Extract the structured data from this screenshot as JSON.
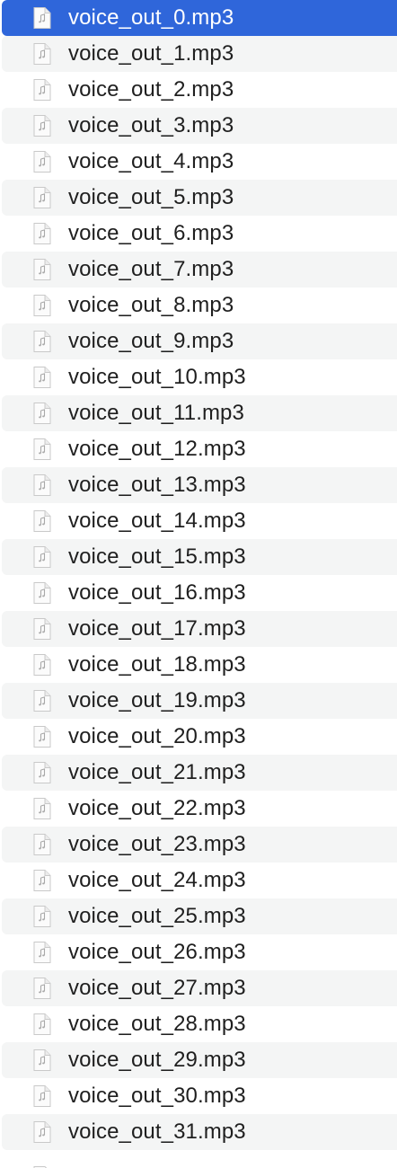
{
  "files": [
    {
      "name": "voice_out_0.mp3",
      "icon": "audio-file-icon",
      "selected": true
    },
    {
      "name": "voice_out_1.mp3",
      "icon": "audio-file-icon",
      "selected": false
    },
    {
      "name": "voice_out_2.mp3",
      "icon": "audio-file-icon",
      "selected": false
    },
    {
      "name": "voice_out_3.mp3",
      "icon": "audio-file-icon",
      "selected": false
    },
    {
      "name": "voice_out_4.mp3",
      "icon": "audio-file-icon",
      "selected": false
    },
    {
      "name": "voice_out_5.mp3",
      "icon": "audio-file-icon",
      "selected": false
    },
    {
      "name": "voice_out_6.mp3",
      "icon": "audio-file-icon",
      "selected": false
    },
    {
      "name": "voice_out_7.mp3",
      "icon": "audio-file-icon",
      "selected": false
    },
    {
      "name": "voice_out_8.mp3",
      "icon": "audio-file-icon",
      "selected": false
    },
    {
      "name": "voice_out_9.mp3",
      "icon": "audio-file-icon",
      "selected": false
    },
    {
      "name": "voice_out_10.mp3",
      "icon": "audio-file-icon",
      "selected": false
    },
    {
      "name": "voice_out_11.mp3",
      "icon": "audio-file-icon",
      "selected": false
    },
    {
      "name": "voice_out_12.mp3",
      "icon": "audio-file-icon",
      "selected": false
    },
    {
      "name": "voice_out_13.mp3",
      "icon": "audio-file-icon",
      "selected": false
    },
    {
      "name": "voice_out_14.mp3",
      "icon": "audio-file-icon",
      "selected": false
    },
    {
      "name": "voice_out_15.mp3",
      "icon": "audio-file-icon",
      "selected": false
    },
    {
      "name": "voice_out_16.mp3",
      "icon": "audio-file-icon",
      "selected": false
    },
    {
      "name": "voice_out_17.mp3",
      "icon": "audio-file-icon",
      "selected": false
    },
    {
      "name": "voice_out_18.mp3",
      "icon": "audio-file-icon",
      "selected": false
    },
    {
      "name": "voice_out_19.mp3",
      "icon": "audio-file-icon",
      "selected": false
    },
    {
      "name": "voice_out_20.mp3",
      "icon": "audio-file-icon",
      "selected": false
    },
    {
      "name": "voice_out_21.mp3",
      "icon": "audio-file-icon",
      "selected": false
    },
    {
      "name": "voice_out_22.mp3",
      "icon": "audio-file-icon",
      "selected": false
    },
    {
      "name": "voice_out_23.mp3",
      "icon": "audio-file-icon",
      "selected": false
    },
    {
      "name": "voice_out_24.mp3",
      "icon": "audio-file-icon",
      "selected": false
    },
    {
      "name": "voice_out_25.mp3",
      "icon": "audio-file-icon",
      "selected": false
    },
    {
      "name": "voice_out_26.mp3",
      "icon": "audio-file-icon",
      "selected": false
    },
    {
      "name": "voice_out_27.mp3",
      "icon": "audio-file-icon",
      "selected": false
    },
    {
      "name": "voice_out_28.mp3",
      "icon": "audio-file-icon",
      "selected": false
    },
    {
      "name": "voice_out_29.mp3",
      "icon": "audio-file-icon",
      "selected": false
    },
    {
      "name": "voice_out_30.mp3",
      "icon": "audio-file-icon",
      "selected": false
    },
    {
      "name": "voice_out_31.mp3",
      "icon": "audio-file-icon",
      "selected": false
    }
  ],
  "colors": {
    "selection": "#2f66da",
    "alternate_row": "#f4f5f5",
    "text": "#1f1f1f",
    "selected_text": "#ffffff"
  }
}
